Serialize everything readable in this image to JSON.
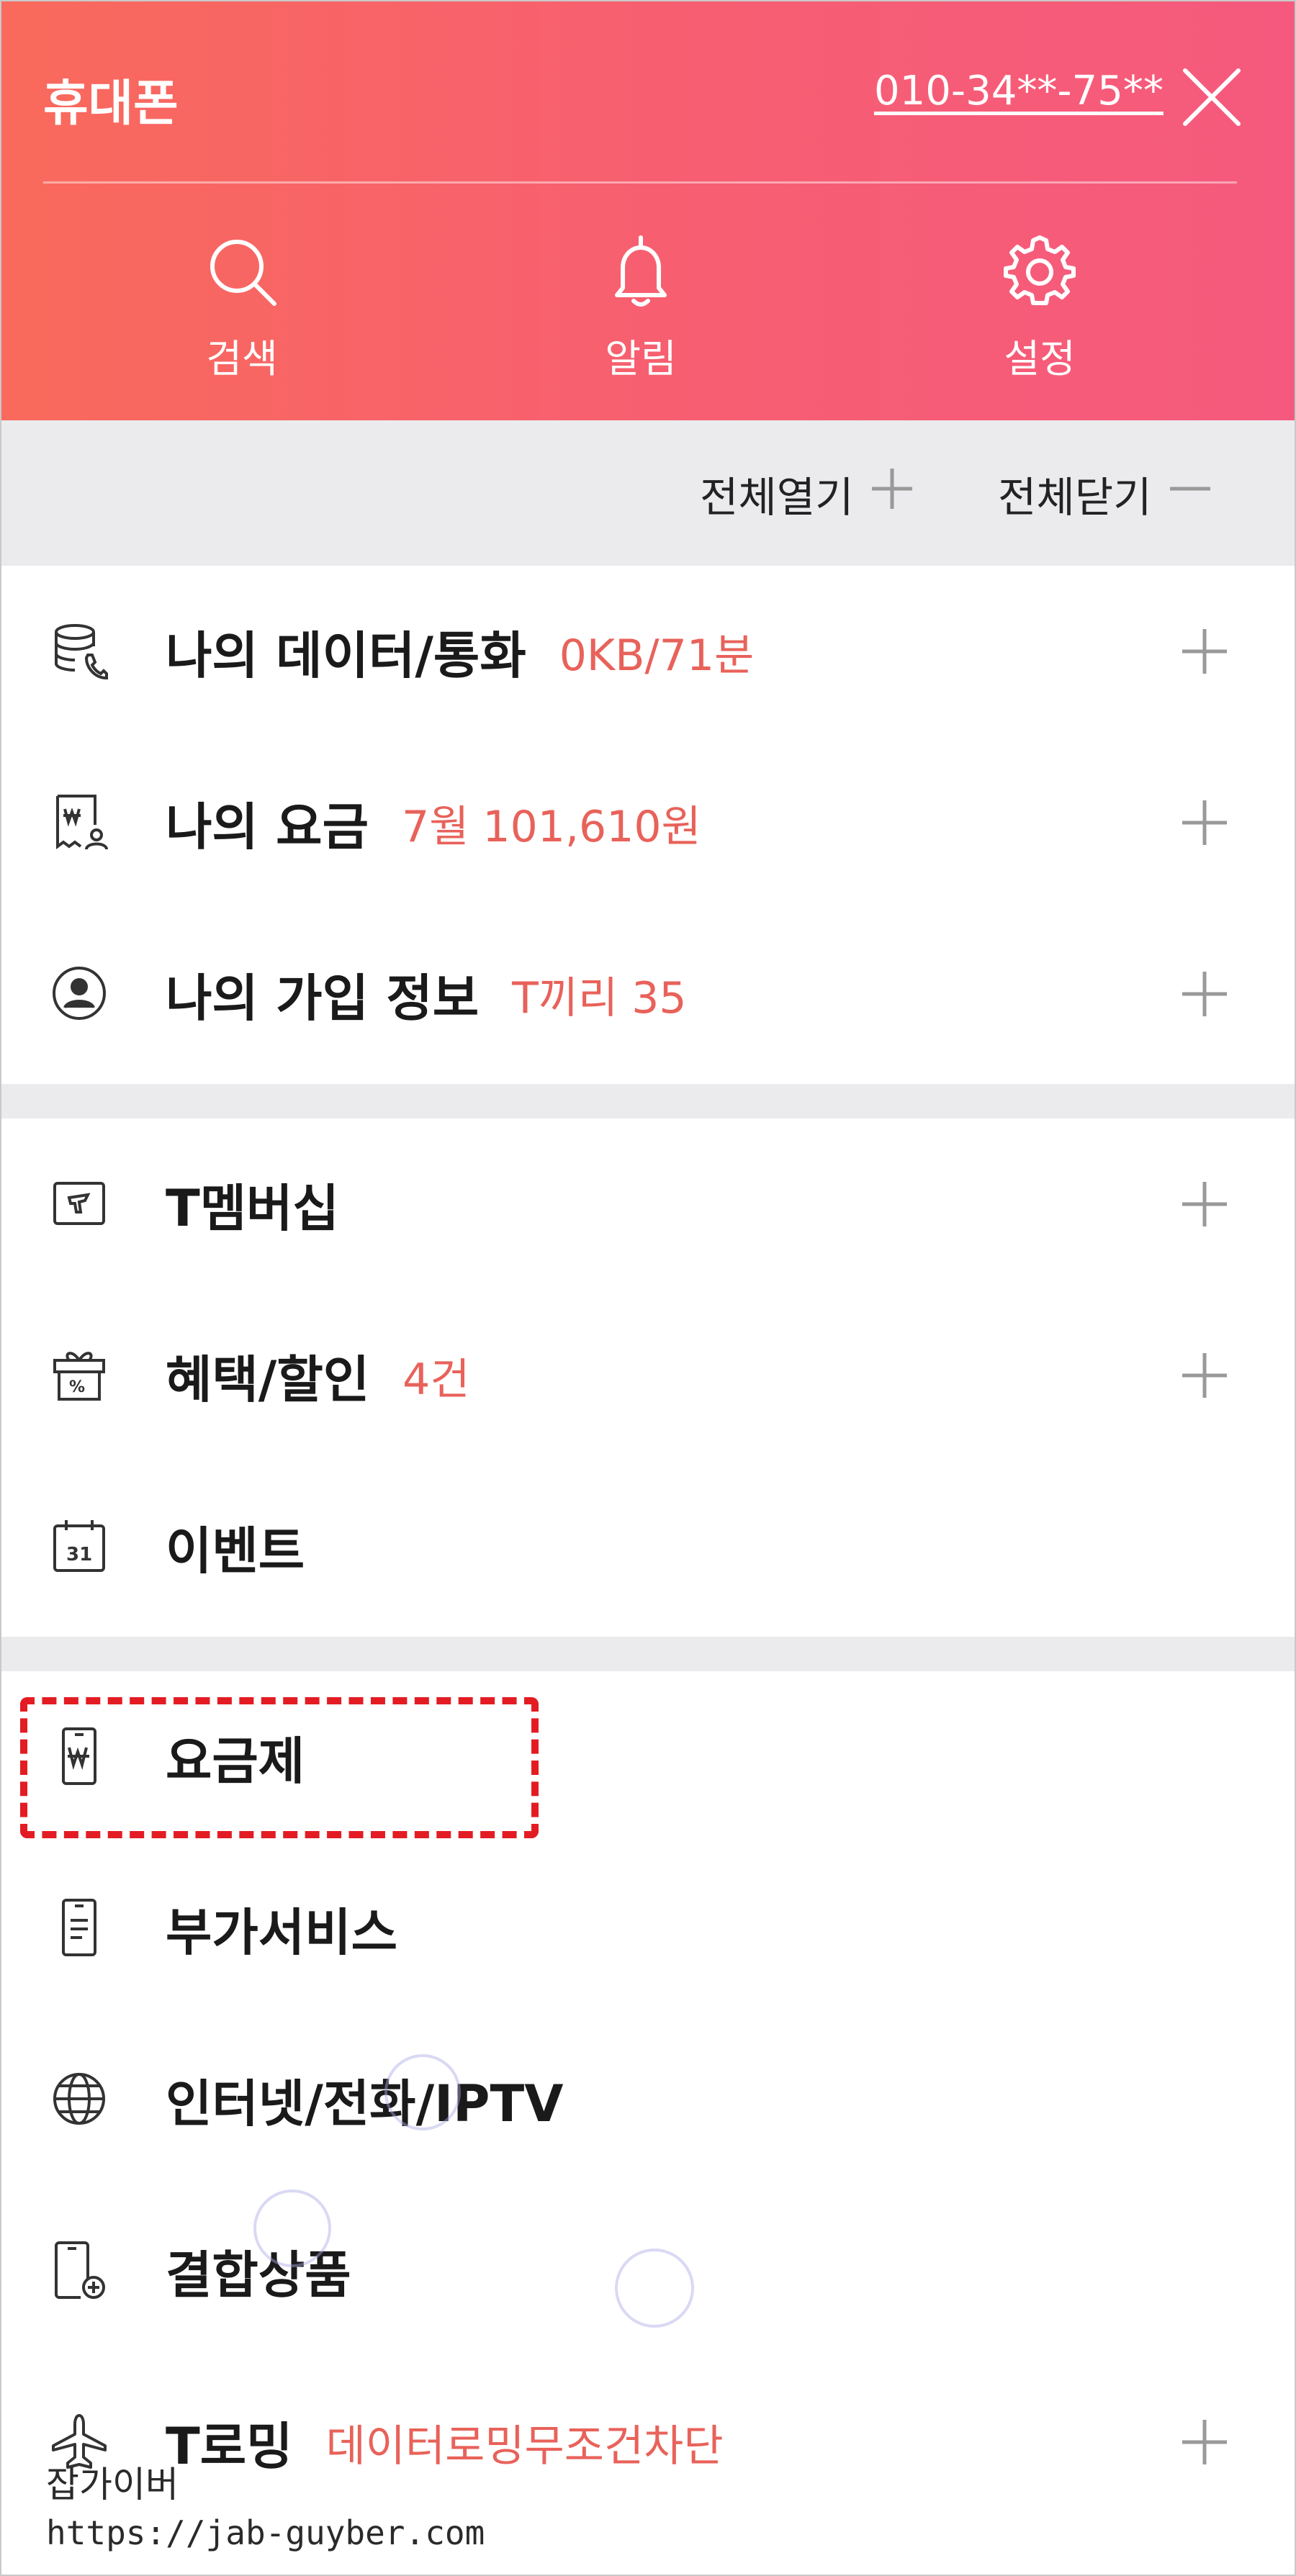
{
  "header": {
    "title": "휴대폰",
    "phone": "010-34**-75**",
    "close_icon": "close-icon",
    "actions": [
      {
        "label": "검색",
        "icon": "search-icon"
      },
      {
        "label": "알림",
        "icon": "bell-icon"
      },
      {
        "label": "설정",
        "icon": "gear-icon"
      }
    ],
    "colors": {
      "gradient_start": "#f96a5c",
      "gradient_end": "#f55a7e"
    }
  },
  "controls": {
    "expand_all": "전체열기",
    "collapse_all": "전체닫기"
  },
  "menu": {
    "section1": [
      {
        "label": "나의 데이터/통화",
        "extra": "0KB/71분",
        "icon": "database-phone-icon"
      },
      {
        "label": "나의 요금",
        "extra": "7월 101,610원",
        "icon": "bill-icon"
      },
      {
        "label": "나의 가입 정보",
        "extra": "T끼리 35",
        "icon": "user-circle-icon"
      }
    ],
    "section2": [
      {
        "label": "T멤버십",
        "extra": "",
        "icon": "membership-card-icon"
      },
      {
        "label": "혜택/할인",
        "extra": "4건",
        "icon": "gift-icon"
      },
      {
        "label": "이벤트",
        "extra": "",
        "icon": "calendar-icon",
        "calendar_day": "31"
      }
    ],
    "section3": [
      {
        "label": "요금제",
        "extra": "",
        "icon": "phone-won-icon"
      },
      {
        "label": "부가서비스",
        "extra": "",
        "icon": "phone-list-icon"
      },
      {
        "label": "인터넷/전화/IPTV",
        "extra": "",
        "icon": "globe-icon"
      },
      {
        "label": "결합상품",
        "extra": "",
        "icon": "phone-plus-icon"
      },
      {
        "label": "T로밍",
        "extra": "데이터로밍무조건차단",
        "icon": "airplane-icon"
      }
    ],
    "accent_color": "#e8625a",
    "highlight_color": "#e31c23"
  },
  "watermark": {
    "name": "잡가이버",
    "url": "https://jab-guyber.com"
  }
}
